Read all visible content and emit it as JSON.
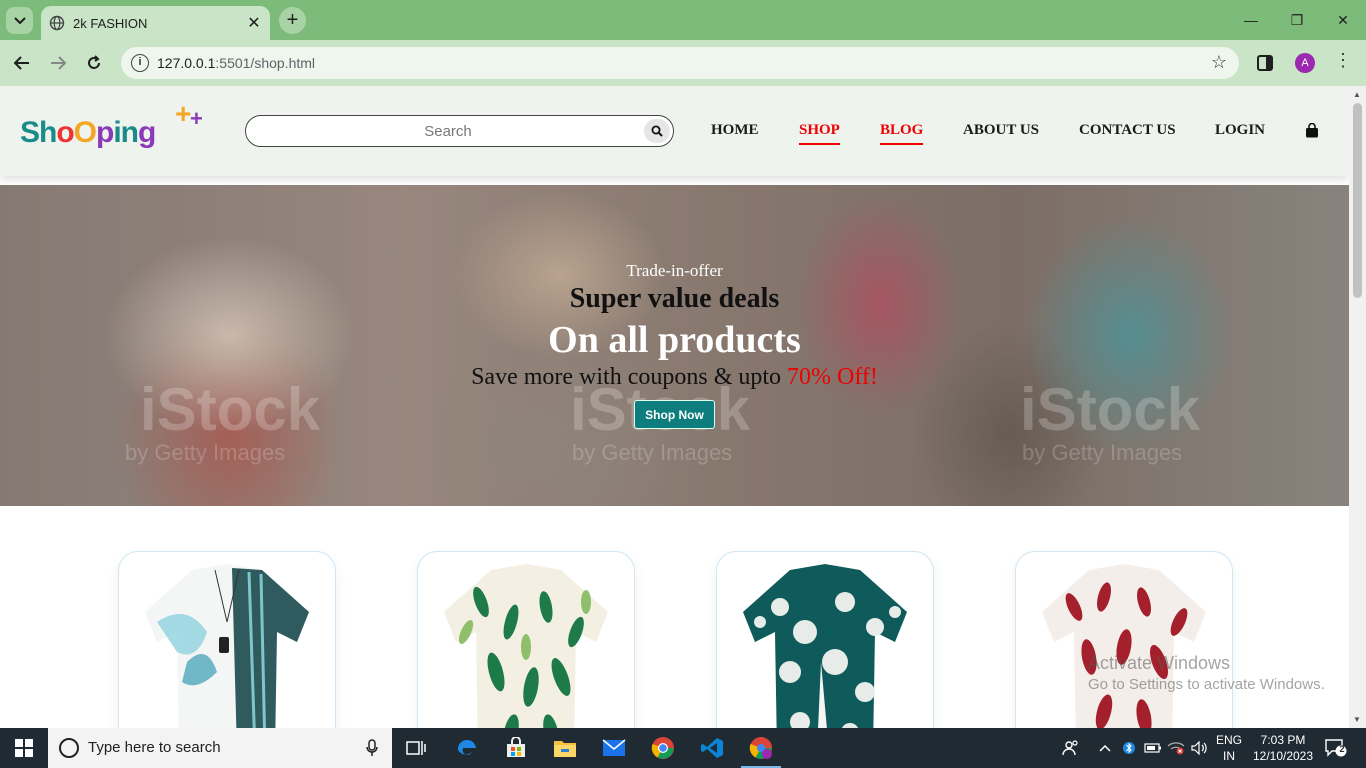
{
  "browser": {
    "tab_title": "2k FASHION",
    "url_host": "127.0.0.1",
    "url_rest": ":5501/shop.html",
    "profile_initial": "A"
  },
  "header": {
    "logo_text": "ShoOping",
    "search_placeholder": "Search",
    "nav": [
      {
        "label": "HOME"
      },
      {
        "label": "SHOP",
        "active": true
      },
      {
        "label": "BLOG",
        "active": true
      },
      {
        "label": "ABOUT US"
      },
      {
        "label": "CONTACT US"
      },
      {
        "label": "LOGIN"
      }
    ]
  },
  "hero": {
    "kicker": "Trade-in-offer",
    "headline": "Super value deals",
    "subheadline": "On all products",
    "tagline_prefix": "Save more with coupons & upto ",
    "tagline_offer": "70% Off!",
    "cta": "Shop Now",
    "watermark_brand": "iStock",
    "watermark_by": "by Getty Images"
  },
  "products": [
    {
      "name": "shirt-1"
    },
    {
      "name": "shirt-2"
    },
    {
      "name": "shirt-3"
    },
    {
      "name": "shirt-4"
    }
  ],
  "overlay": {
    "activate_title": "Activate Windows",
    "activate_sub": "Go to Settings to activate Windows."
  },
  "taskbar": {
    "search_placeholder": "Type here to search",
    "lang_top": "ENG",
    "lang_bottom": "IN",
    "time": "7:03 PM",
    "date": "12/10/2023",
    "notification_count": "2"
  },
  "colors": {
    "tabbar": "#7dbb7a",
    "accent_red": "#ee0000",
    "cta_teal": "#0d7d7d"
  }
}
